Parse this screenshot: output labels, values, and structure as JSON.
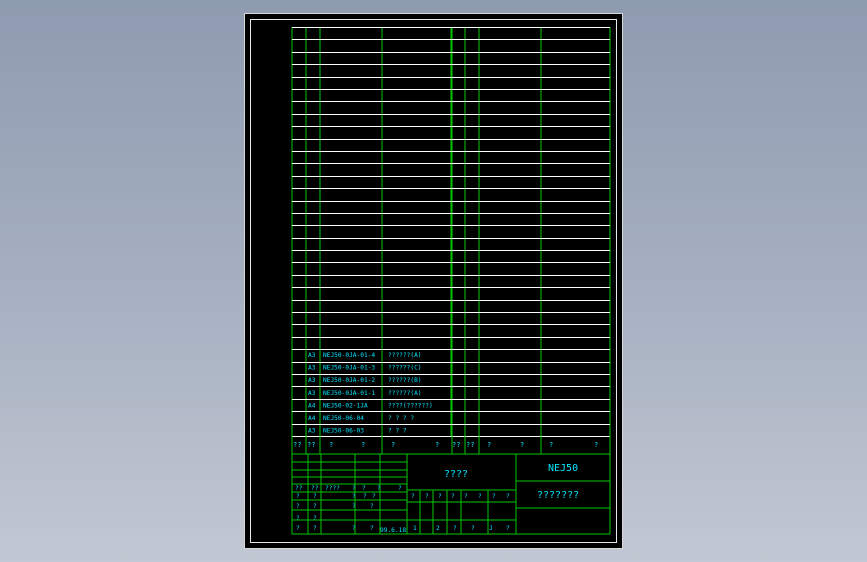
{
  "list_rows": [
    {
      "size": "A3",
      "code": "NEJ50-0JA-01-4",
      "name": "??????(A)"
    },
    {
      "size": "A3",
      "code": "NEJ50-0JA-01-3",
      "name": "??????(C)"
    },
    {
      "size": "A3",
      "code": "NEJ50-0JA-01-2",
      "name": "??????(B)"
    },
    {
      "size": "A3",
      "code": "NEJ50-0JA-01-1",
      "name": "??????(A)"
    },
    {
      "size": "A4",
      "code": "NEJ50-02-1JA",
      "name": "????(??????)"
    },
    {
      "size": "A4",
      "code": "NEJ50-06-04",
      "name": "?  ?  ?  ?"
    },
    {
      "size": "A3",
      "code": "NEJ50-06-03",
      "name": "?   ?   ?"
    }
  ],
  "header_row": [
    "??",
    "??",
    "?",
    "?",
    "?",
    "?",
    "??",
    "??",
    "?",
    "?",
    "?",
    "?",
    "?"
  ],
  "title_block": {
    "drawing_name": "????",
    "product_code": "NEJ50",
    "doc_type": "???????",
    "date": "99.6.18",
    "labels_row1": [
      "??",
      "??",
      "????",
      "?",
      "?",
      "?",
      "?"
    ],
    "labels_row2": [
      "?",
      "?",
      "?",
      "?",
      "?"
    ],
    "labels_row3": [
      "?",
      "?",
      "?",
      "?",
      "?",
      "?",
      "?",
      "?",
      "?",
      "?",
      "?"
    ],
    "labels_row4": [
      "?",
      "?",
      "?",
      "?"
    ],
    "labels_row5": [
      "?",
      "?"
    ],
    "labels_row6": [
      "?",
      "?",
      "?",
      "?",
      "1",
      "2",
      "?",
      "?",
      "J",
      "?"
    ]
  }
}
